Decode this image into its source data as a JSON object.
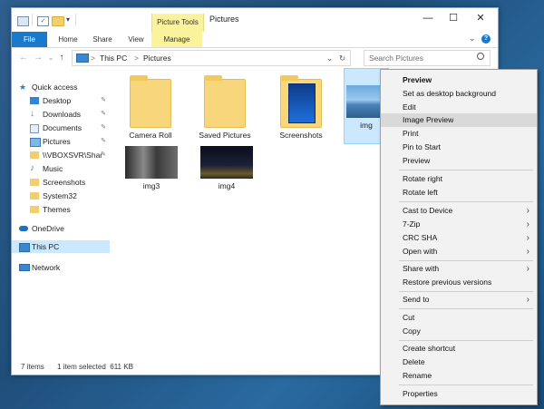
{
  "window": {
    "title": "Pictures",
    "contextual_tab": "Picture Tools",
    "controls": {
      "minimize": "—",
      "maximize": "☐",
      "close": "✕"
    }
  },
  "ribbon": {
    "tabs": [
      "File",
      "Home",
      "Share",
      "View",
      "Manage"
    ],
    "expand": "⌄",
    "help": "?"
  },
  "address": {
    "crumbs": [
      "This PC",
      "Pictures"
    ],
    "separator": ">",
    "dropdown": "⌄",
    "refresh": "↻",
    "search_placeholder": "Search Pictures"
  },
  "nav": {
    "back": "←",
    "forward": "→",
    "recent": "⌄",
    "up": "↑",
    "items": [
      {
        "label": "Quick access",
        "icon": "star-icon",
        "level": 0
      },
      {
        "label": "Desktop",
        "icon": "desktop-icon",
        "level": 1,
        "pinned": true
      },
      {
        "label": "Downloads",
        "icon": "download-icon",
        "level": 1,
        "pinned": true
      },
      {
        "label": "Documents",
        "icon": "documents-icon",
        "level": 1,
        "pinned": true
      },
      {
        "label": "Pictures",
        "icon": "pictures-icon",
        "level": 1,
        "pinned": true
      },
      {
        "label": "\\\\VBOXSVR\\Shar",
        "icon": "folder-icon",
        "level": 1,
        "pinned": true
      },
      {
        "label": "Music",
        "icon": "music-icon",
        "level": 1
      },
      {
        "label": "Screenshots",
        "icon": "folder-icon",
        "level": 1
      },
      {
        "label": "System32",
        "icon": "folder-icon",
        "level": 1
      },
      {
        "label": "Themes",
        "icon": "folder-icon",
        "level": 1
      },
      {
        "label": "OneDrive",
        "icon": "cloud-icon",
        "level": 0
      },
      {
        "label": "This PC",
        "icon": "computer-icon",
        "level": 0,
        "selected": true
      },
      {
        "label": "Network",
        "icon": "network-icon",
        "level": 0
      }
    ],
    "pin_glyph": "📌"
  },
  "files": [
    {
      "name": "Camera Roll",
      "type": "folder"
    },
    {
      "name": "Saved Pictures",
      "type": "folder"
    },
    {
      "name": "Screenshots",
      "type": "folder"
    },
    {
      "name": "img",
      "type": "image",
      "selected": true
    },
    {
      "name": "img3",
      "type": "image"
    },
    {
      "name": "img4",
      "type": "image"
    }
  ],
  "status": {
    "count": "7 items",
    "selection": "1 item selected  611 KB"
  },
  "context_menu": {
    "submenu_glyph": "›",
    "groups": [
      [
        {
          "label": "Preview",
          "bold": true
        },
        {
          "label": "Set as desktop background"
        },
        {
          "label": "Edit"
        },
        {
          "label": "Image Preview",
          "highlighted": true
        },
        {
          "label": "Print"
        },
        {
          "label": "Pin to Start"
        },
        {
          "label": "Preview"
        }
      ],
      [
        {
          "label": "Rotate right"
        },
        {
          "label": "Rotate left"
        }
      ],
      [
        {
          "label": "Cast to Device",
          "submenu": true
        },
        {
          "label": "7-Zip",
          "submenu": true
        },
        {
          "label": "CRC SHA",
          "submenu": true
        },
        {
          "label": "Open with",
          "submenu": true
        }
      ],
      [
        {
          "label": "Share with",
          "submenu": true
        },
        {
          "label": "Restore previous versions"
        }
      ],
      [
        {
          "label": "Send to",
          "submenu": true
        }
      ],
      [
        {
          "label": "Cut"
        },
        {
          "label": "Copy"
        }
      ],
      [
        {
          "label": "Create shortcut"
        },
        {
          "label": "Delete"
        },
        {
          "label": "Rename"
        }
      ],
      [
        {
          "label": "Properties"
        }
      ]
    ]
  }
}
